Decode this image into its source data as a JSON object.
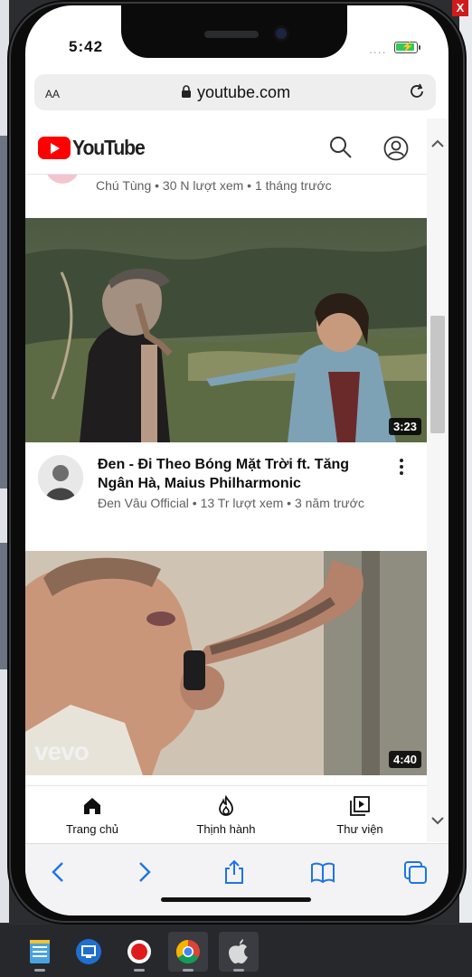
{
  "window": {
    "close_label": "X"
  },
  "status": {
    "time": "5:42",
    "dots": "...."
  },
  "browser": {
    "text_size_label": "AA",
    "url": "youtube.com"
  },
  "youtube": {
    "logo_text": "YouTube",
    "previous_video": {
      "meta": "Chú Tùng • 30 N lượt xem • 1 tháng trước"
    },
    "videos": [
      {
        "title": "Đen - Đi Theo Bóng Mặt Trời ft. Tăng Ngân Hà, Maius Philharmonic",
        "meta": "Đen Vâu Official • 13 Tr lượt xem • 3 năm trước",
        "duration": "3:23"
      },
      {
        "watermark": "vevo",
        "duration": "4:40"
      }
    ],
    "nav": [
      {
        "label": "Trang chủ",
        "icon": "home-icon"
      },
      {
        "label": "Thịnh hành",
        "icon": "flame-icon"
      },
      {
        "label": "Thư viện",
        "icon": "library-icon"
      }
    ]
  },
  "safari_toolbar": [
    "back-icon",
    "forward-icon",
    "share-icon",
    "bookmarks-icon",
    "tabs-icon"
  ],
  "taskbar": [
    "notepad-icon",
    "remote-desktop-icon",
    "record-icon",
    "chrome-icon",
    "apple-icon"
  ],
  "colors": {
    "brand": "#ff0000",
    "text": "#0f0f0f",
    "meta": "#606060"
  }
}
